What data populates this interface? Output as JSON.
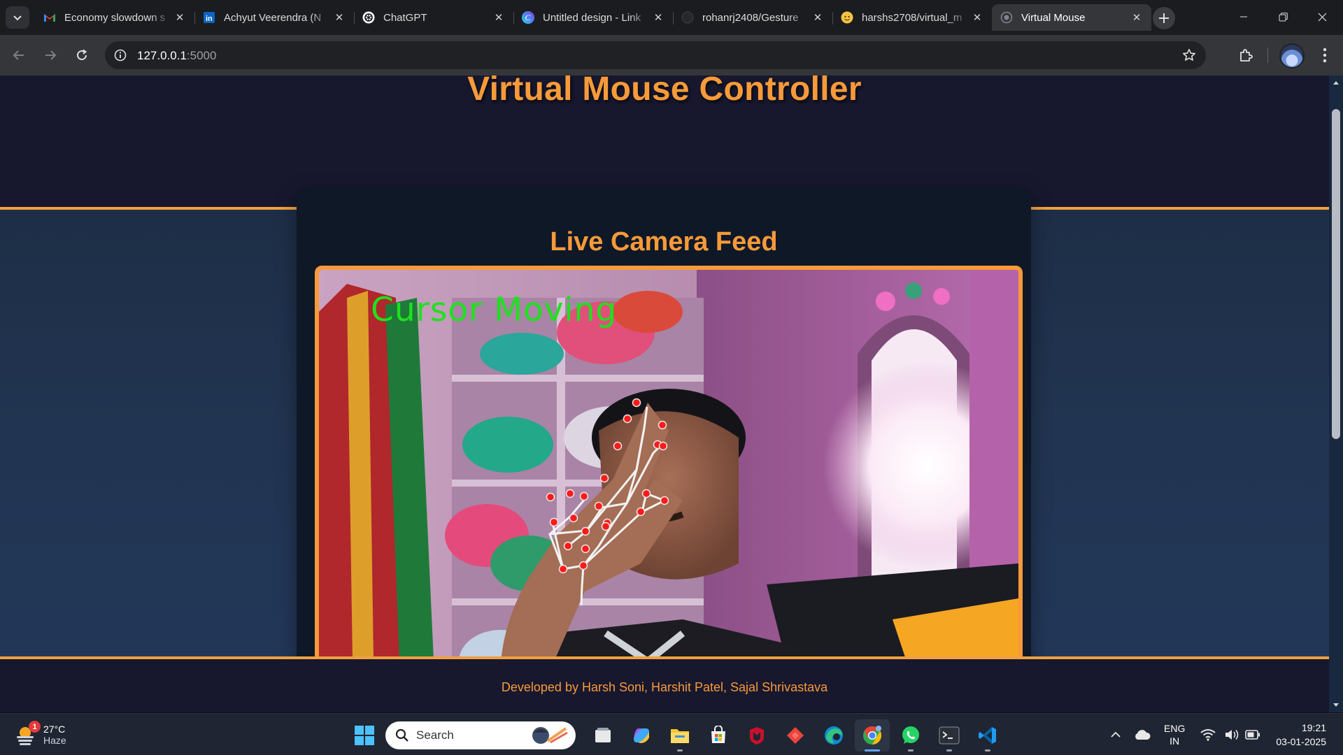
{
  "browser": {
    "tabs": [
      {
        "title": "Economy slowdown s",
        "favicon": "gmail-icon"
      },
      {
        "title": "Achyut Veerendra (N",
        "favicon": "linkedin-icon"
      },
      {
        "title": "ChatGPT",
        "favicon": "chatgpt-icon"
      },
      {
        "title": "Untitled design - Link",
        "favicon": "canva-icon"
      },
      {
        "title": "rohanrj2408/Gesture",
        "favicon": "github-icon"
      },
      {
        "title": "harshs2708/virtual_m",
        "favicon": "github-icon"
      },
      {
        "title": "Virtual Mouse",
        "favicon": "globe-icon",
        "active": true
      }
    ],
    "url_host": "127.0.0.1",
    "url_port": ":5000",
    "accent": "#f79a3a"
  },
  "page": {
    "title": "Virtual Mouse Controller",
    "feed_heading": "Live Camera Feed",
    "overlay_status": "Cursor Moving",
    "footer": "Developed by Harsh Soni, Harshit Patel, Sajal Shrivastava"
  },
  "taskbar": {
    "weather": {
      "temp": "27°C",
      "condition": "Haze",
      "badge": "1"
    },
    "search_placeholder": "Search",
    "apps": [
      "task-view-icon",
      "copilot-icon",
      "file-explorer-icon",
      "microsoft-store-icon",
      "mcafee-icon",
      "anydesk-icon",
      "edge-icon",
      "chrome-icon",
      "whatsapp-icon",
      "terminal-icon",
      "vscode-icon"
    ],
    "lang_line1": "ENG",
    "lang_line2": "IN",
    "time": "19:21",
    "date": "03-01-2025"
  }
}
